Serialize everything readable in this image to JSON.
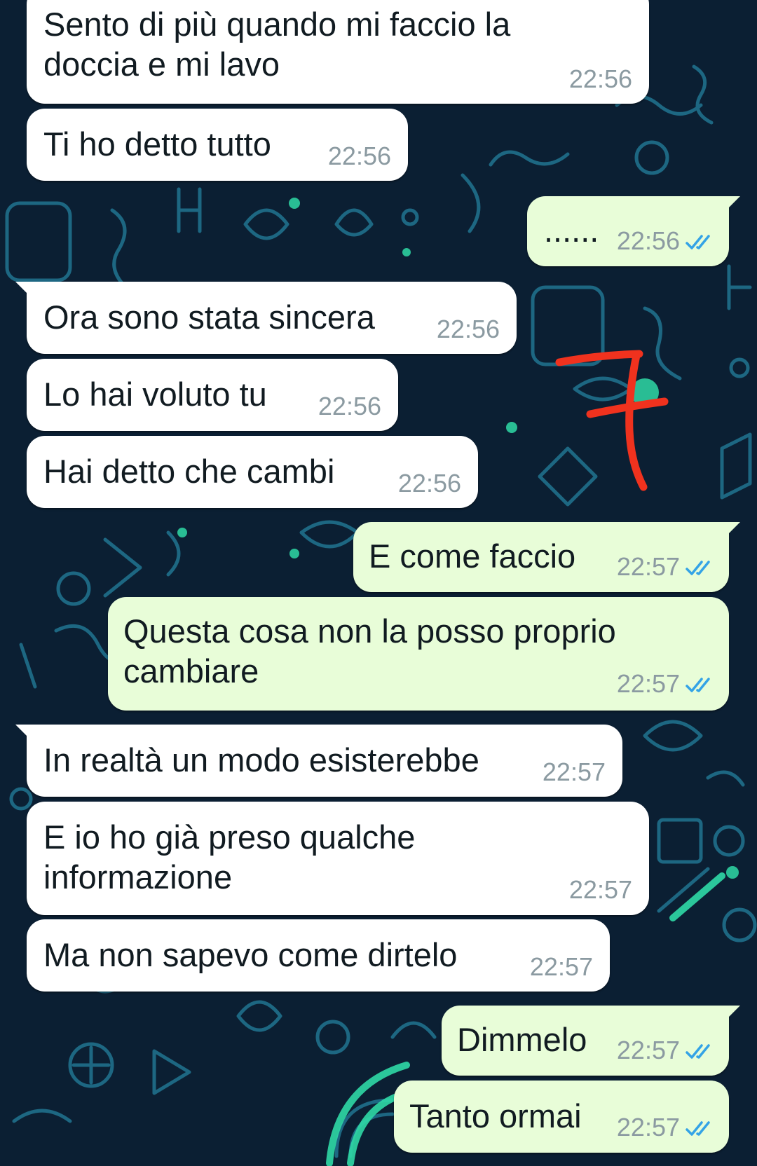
{
  "chat": {
    "messages": [
      {
        "dir": "in",
        "lines": [
          "Sento di più quando mi faccio la",
          "doccia e mi lavo"
        ],
        "time": "22:56"
      },
      {
        "dir": "in",
        "lines": [
          "Ti ho detto tutto"
        ],
        "time": "22:56"
      },
      {
        "dir": "out",
        "lines": [
          "......"
        ],
        "time": "22:56",
        "status": "read"
      },
      {
        "dir": "in",
        "lines": [
          "Ora sono stata sincera"
        ],
        "time": "22:56"
      },
      {
        "dir": "in",
        "lines": [
          "Lo hai voluto tu"
        ],
        "time": "22:56"
      },
      {
        "dir": "in",
        "lines": [
          "Hai detto che cambi"
        ],
        "time": "22:56"
      },
      {
        "dir": "out",
        "lines": [
          "E come faccio"
        ],
        "time": "22:57",
        "status": "read"
      },
      {
        "dir": "out",
        "lines": [
          "Questa cosa non la posso proprio",
          "cambiare"
        ],
        "time": "22:57",
        "status": "read"
      },
      {
        "dir": "in",
        "lines": [
          "In realtà un modo esisterebbe"
        ],
        "time": "22:57"
      },
      {
        "dir": "in",
        "lines": [
          "E io ho già preso qualche",
          "informazione"
        ],
        "time": "22:57"
      },
      {
        "dir": "in",
        "lines": [
          "Ma non sapevo come dirtelo"
        ],
        "time": "22:57"
      },
      {
        "dir": "out",
        "lines": [
          "Dimmelo"
        ],
        "time": "22:57",
        "status": "read"
      },
      {
        "dir": "out",
        "lines": [
          "Tanto ormai"
        ],
        "time": "22:57",
        "status": "read"
      }
    ]
  },
  "icons": {
    "read_receipt": "double-check-icon",
    "annotation": "red-hand-drawn-mark"
  },
  "colors": {
    "wallpaper": "#0b1f33",
    "wallpaper_doodles": "#1f6f8b",
    "wallpaper_accent": "#2fd9a6",
    "incoming_bubble": "#ffffff",
    "outgoing_bubble": "#e8fdd8",
    "message_text": "#111b21",
    "timestamp": "#8b9aa1",
    "read_ticks": "#34a3e6",
    "annotation_red": "#f0321e"
  }
}
